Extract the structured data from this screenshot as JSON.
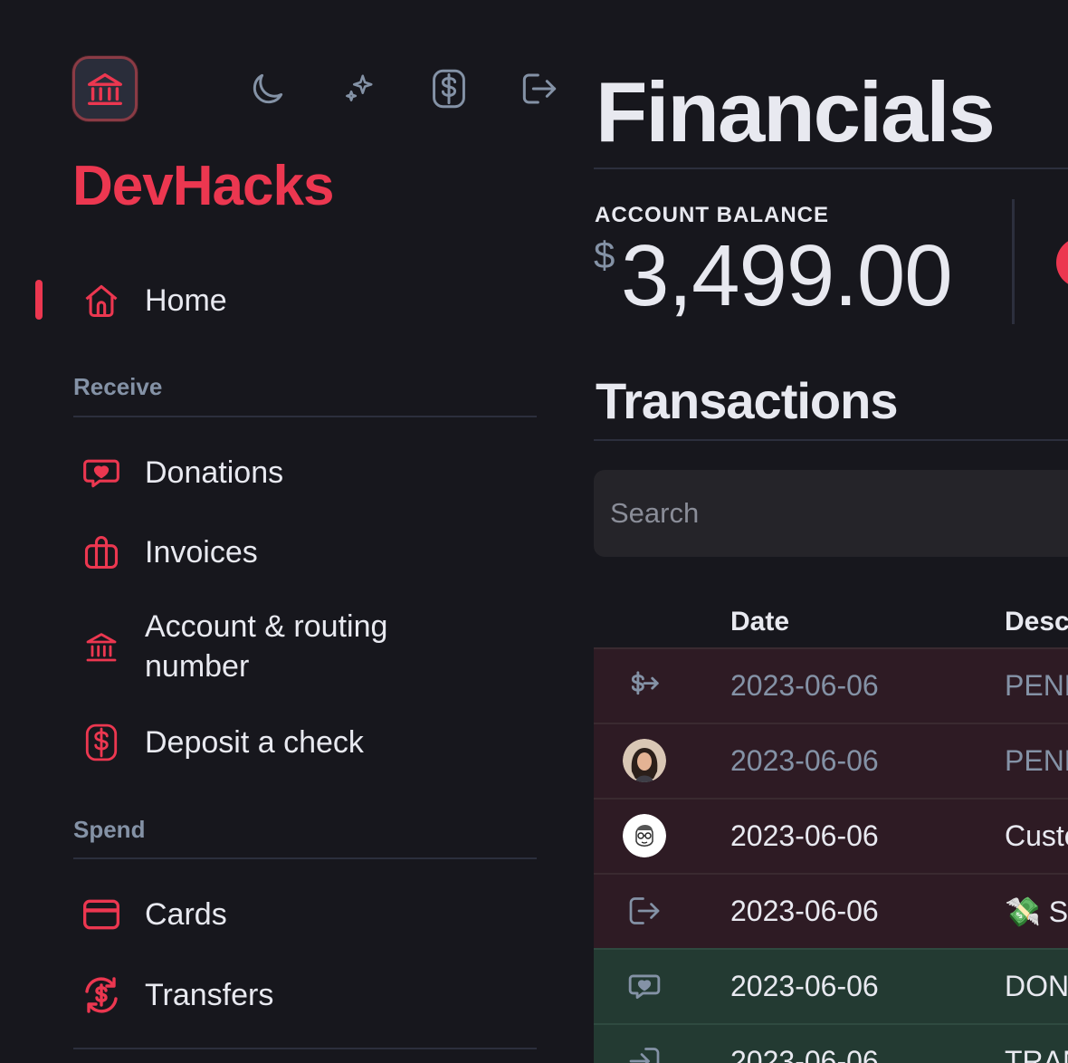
{
  "sidebar": {
    "org_name": "DevHacks",
    "top_icons": [
      "moon-icon",
      "sparkles-icon",
      "dollar-icon",
      "logout-icon"
    ],
    "nav": {
      "home": "Home",
      "receive_heading": "Receive",
      "donations": "Donations",
      "invoices": "Invoices",
      "account_routing": "Account & routing number",
      "deposit_check": "Deposit a check",
      "spend_heading": "Spend",
      "cards": "Cards",
      "transfers": "Transfers"
    },
    "active_item": "Home"
  },
  "main": {
    "title": "Financials",
    "balance_label": "ACCOUNT BALANCE",
    "balance_currency": "$",
    "balance_amount": "3,499.00",
    "transactions_title": "Transactions",
    "search_placeholder": "Search",
    "columns": {
      "date": "Date",
      "description": "Desc"
    },
    "rows": [
      {
        "icon": "transfer-out-icon",
        "date": "2023-06-06",
        "desc": "PEND",
        "type": "out",
        "pending": true
      },
      {
        "icon": "avatar-woman",
        "date": "2023-06-06",
        "desc": "PEND",
        "type": "out",
        "pending": true
      },
      {
        "icon": "avatar-sketch",
        "date": "2023-06-06",
        "desc": "Custo",
        "type": "out",
        "pending": false
      },
      {
        "icon": "logout-icon",
        "date": "2023-06-06",
        "desc": "💸 Sa",
        "type": "out",
        "pending": false
      },
      {
        "icon": "donation-icon",
        "date": "2023-06-06",
        "desc": "DON",
        "type": "in",
        "pending": false
      },
      {
        "icon": "login-icon",
        "date": "2023-06-06",
        "desc": "TRAN",
        "type": "in",
        "pending": false
      }
    ]
  },
  "colors": {
    "background": "#17171d",
    "accent": "#ec3750",
    "muted": "#8492a6",
    "row_out": "#2e1b24",
    "row_in": "#233a32"
  }
}
